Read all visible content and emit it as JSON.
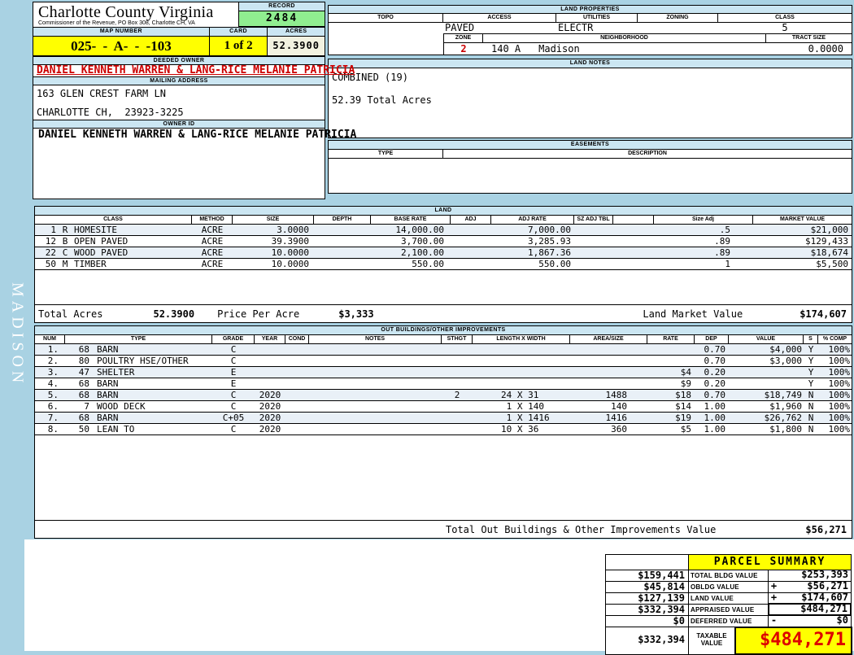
{
  "colors": {
    "page_bg": "#a9d2e3",
    "section_bar_bg": "#cbe6f2",
    "highlight_yellow": "#ffff00",
    "record_green": "#90ee90",
    "acres_cream": "#f2f2e0",
    "alert_red": "#cc0000"
  },
  "sidebar": {
    "district": "MADISON"
  },
  "header": {
    "county": "Charlotte County Virginia",
    "commissioner": "Commissioner of the Revenue, PO Box 308, Charlotte CH, VA",
    "record_label": "RECORD",
    "record": "2484",
    "map_number_label": "MAP NUMBER",
    "map_number": "025- - A- - -103",
    "card_label": "CARD",
    "card": "1 of 2",
    "acres_label": "ACRES",
    "acres": "52.3900"
  },
  "owner": {
    "deeded_owner_label": "DEEDED OWNER",
    "deeded_owner": "DANIEL KENNETH WARREN & LANG-RICE MELANIE PATRICIA",
    "mailing_address_label": "MAILING ADDRESS",
    "address_line1": "163 GLEN CREST FARM LN",
    "address_line2": "CHARLOTTE CH,  23923-3225",
    "owner_id_label": "OWNER ID",
    "owner_id": "DANIEL KENNETH WARREN & LANG-RICE MELANIE PATRICIA"
  },
  "land_properties": {
    "title": "LAND PROPERTIES",
    "topo_label": "TOPO",
    "access_label": "ACCESS",
    "utilities_label": "UTILITIES",
    "zoning_label": "ZONING",
    "class_label": "CLASS",
    "topo": "",
    "access": "PAVED",
    "utilities": "ELECTR",
    "zoning": "",
    "class": "5",
    "zone_label": "ZONE",
    "neighborhood_label": "NEIGHBORHOOD",
    "tract_size_label": "TRACT SIZE",
    "zone": "2",
    "neighborhood_code": "140 A",
    "neighborhood_name": "Madison",
    "tract_size": "0.0000"
  },
  "land_notes": {
    "title": "LAND NOTES",
    "line1": "COMBINED (19)",
    "line2": "52.39 Total Acres"
  },
  "easements": {
    "title": "EASEMENTS",
    "type_label": "TYPE",
    "description_label": "DESCRIPTION"
  },
  "land": {
    "title": "LAND",
    "headers": {
      "class": "CLASS",
      "method": "METHOD",
      "size": "SIZE",
      "depth": "DEPTH",
      "base_rate": "BASE RATE",
      "adj": "ADJ",
      "adj_rate": "ADJ RATE",
      "sz_adj_tbl": "SZ ADJ TBL",
      "blank": "",
      "size_adj": "Size Adj",
      "market": "MARKET VALUE"
    },
    "rows": [
      {
        "num": "1",
        "code": "R",
        "name": "HOMESITE",
        "method": "ACRE",
        "size": "3.0000",
        "depth": "",
        "base_rate": "14,000.00",
        "adj": "",
        "adj_rate": "7,000.00",
        "sz_adj_tbl": "",
        "size_adj": ".5",
        "market": "$21,000"
      },
      {
        "num": "12",
        "code": "B",
        "name": "OPEN PAVED",
        "method": "ACRE",
        "size": "39.3900",
        "depth": "",
        "base_rate": "3,700.00",
        "adj": "",
        "adj_rate": "3,285.93",
        "sz_adj_tbl": "",
        "size_adj": ".89",
        "market": "$129,433"
      },
      {
        "num": "22",
        "code": "C",
        "name": "WOOD PAVED",
        "method": "ACRE",
        "size": "10.0000",
        "depth": "",
        "base_rate": "2,100.00",
        "adj": "",
        "adj_rate": "1,867.36",
        "sz_adj_tbl": "",
        "size_adj": ".89",
        "market": "$18,674"
      },
      {
        "num": "50",
        "code": "M",
        "name": "TIMBER",
        "method": "ACRE",
        "size": "10.0000",
        "depth": "",
        "base_rate": "550.00",
        "adj": "",
        "adj_rate": "550.00",
        "sz_adj_tbl": "",
        "size_adj": "1",
        "market": "$5,500"
      }
    ],
    "totals": {
      "total_acres_label": "Total Acres",
      "total_acres": "52.3900",
      "price_per_acre_label": "Price Per Acre",
      "price_per_acre": "$3,333",
      "market_value_label": "Land Market Value",
      "market_value": "$174,607"
    }
  },
  "out_buildings": {
    "title": "OUT BUILDINGS/OTHER IMPROVEMENTS",
    "headers": {
      "num": "NUM",
      "type": "TYPE",
      "grade": "GRADE",
      "year": "YEAR",
      "cond": "COND",
      "notes": "NOTES",
      "sthgt": "STHGT",
      "length_width": "LENGTH X WIDTH",
      "area_size": "AREA/SIZE",
      "rate": "RATE",
      "dep": "DEP",
      "value": "VALUE",
      "s": "S",
      "pct_comp": "% COMP"
    },
    "rows": [
      {
        "num": "1.",
        "code": "68",
        "type": "BARN",
        "grade": "C",
        "year": "",
        "cond": "",
        "notes": "",
        "sthgt": "",
        "lw": "",
        "area": "",
        "rate": "",
        "dep": "0.70",
        "value": "$4,000",
        "s": "Y",
        "pct": "100%"
      },
      {
        "num": "2.",
        "code": "80",
        "type": "POULTRY HSE/OTHER",
        "grade": "C",
        "year": "",
        "cond": "",
        "notes": "",
        "sthgt": "",
        "lw": "",
        "area": "",
        "rate": "",
        "dep": "0.70",
        "value": "$3,000",
        "s": "Y",
        "pct": "100%"
      },
      {
        "num": "3.",
        "code": "47",
        "type": "SHELTER",
        "grade": "E",
        "year": "",
        "cond": "",
        "notes": "",
        "sthgt": "",
        "lw": "",
        "area": "",
        "rate": "$4",
        "dep": "0.20",
        "value": "",
        "s": "Y",
        "pct": "100%"
      },
      {
        "num": "4.",
        "code": "68",
        "type": "BARN",
        "grade": "E",
        "year": "",
        "cond": "",
        "notes": "",
        "sthgt": "",
        "lw": "",
        "area": "",
        "rate": "$9",
        "dep": "0.20",
        "value": "",
        "s": "Y",
        "pct": "100%"
      },
      {
        "num": "5.",
        "code": "68",
        "type": "BARN",
        "grade": "C",
        "year": "2020",
        "cond": "",
        "notes": "",
        "sthgt": "2",
        "lw": "24 X 31",
        "area": "1488",
        "rate": "$18",
        "dep": "0.70",
        "value": "$18,749",
        "s": "N",
        "pct": "100%"
      },
      {
        "num": "6.",
        "code": "7",
        "type": "WOOD DECK",
        "grade": "C",
        "year": "2020",
        "cond": "",
        "notes": "",
        "sthgt": "",
        "lw": " 1 X 140",
        "area": "140",
        "rate": "$14",
        "dep": "1.00",
        "value": "$1,960",
        "s": "N",
        "pct": "100%"
      },
      {
        "num": "7.",
        "code": "68",
        "type": "BARN",
        "grade": "C+05",
        "year": "2020",
        "cond": "",
        "notes": "",
        "sthgt": "",
        "lw": " 1 X 1416",
        "area": "1416",
        "rate": "$19",
        "dep": "1.00",
        "value": "$26,762",
        "s": "N",
        "pct": "100%"
      },
      {
        "num": "8.",
        "code": "50",
        "type": "LEAN TO",
        "grade": "C",
        "year": "2020",
        "cond": "",
        "notes": "",
        "sthgt": "",
        "lw": "10 X 36",
        "area": "360",
        "rate": "$5",
        "dep": "1.00",
        "value": "$1,800",
        "s": "N",
        "pct": "100%"
      }
    ],
    "total_label": "Total Out Buildings & Other Improvements Value",
    "total_value": "$56,271"
  },
  "parcel_summary": {
    "title": "PARCEL SUMMARY",
    "rows": [
      {
        "left": "$159,441",
        "label": "TOTAL BLDG VALUE",
        "op": "",
        "value": "$253,393"
      },
      {
        "left": "$45,814",
        "label": "OBLDG VALUE",
        "op": "+",
        "value": "$56,271"
      },
      {
        "left": "$127,139",
        "label": "LAND VALUE",
        "op": "+",
        "value": "$174,607"
      },
      {
        "left": "$332,394",
        "label": "APPRAISED VALUE",
        "op": "",
        "value": "$484,271"
      },
      {
        "left": "$0",
        "label": "DEFERRED VALUE",
        "op": "-",
        "value": "$0"
      }
    ],
    "taxable": {
      "left": "$332,394",
      "label": "TAXABLE VALUE",
      "value": "$484,271"
    }
  }
}
